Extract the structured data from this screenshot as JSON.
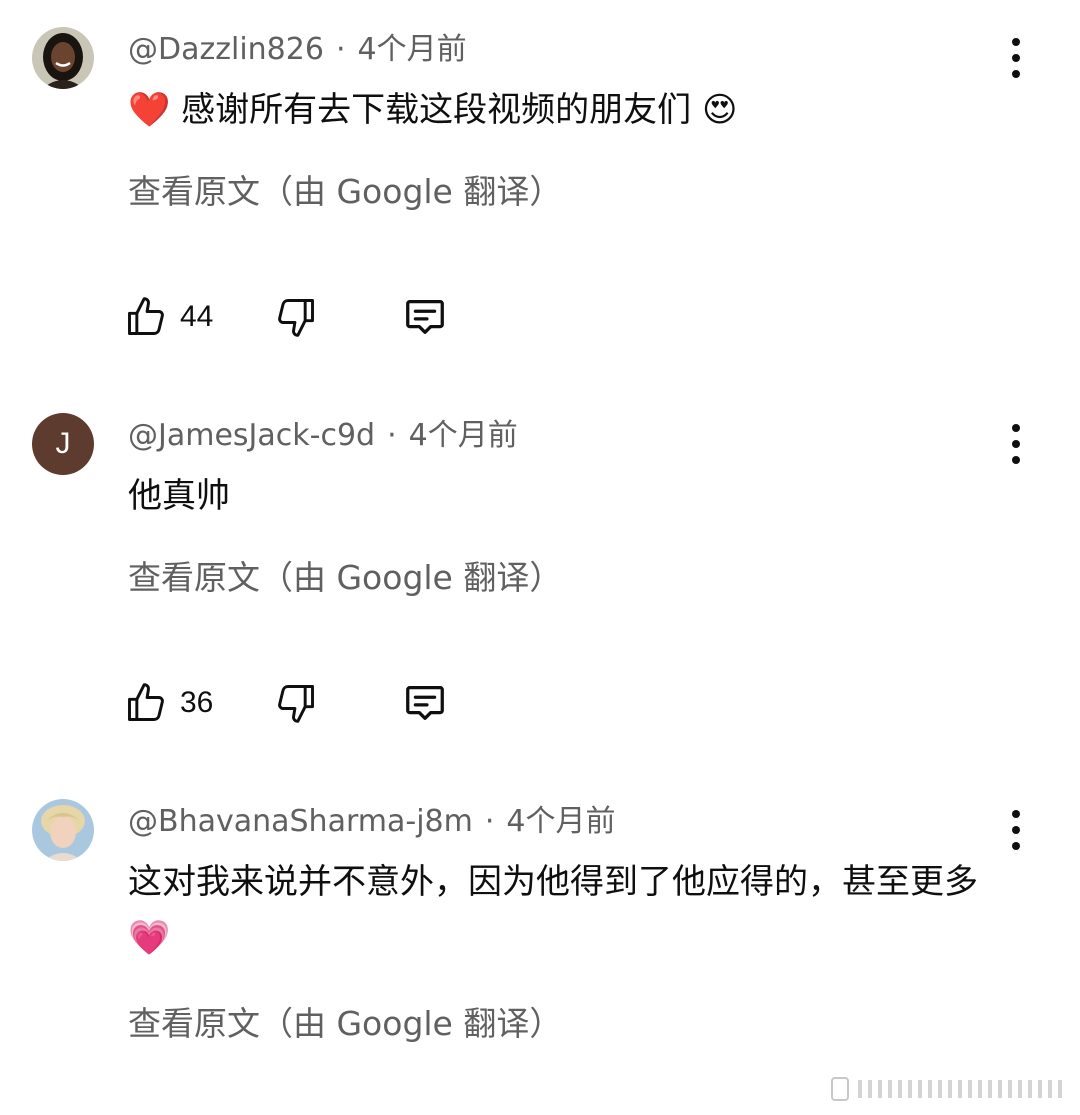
{
  "comments": [
    {
      "handle": "@Dazzlin826",
      "age": "4个月前",
      "text_emoji_lead": "❤️",
      "text": "感谢所有去下载这段视频的朋友们",
      "text_emoji_trail": "😍",
      "translate_label": "查看原文（由 Google 翻译）",
      "likes": "44"
    },
    {
      "handle": "@JamesJack-c9d",
      "age": "4个月前",
      "avatar_letter": "J",
      "text": "他真帅",
      "translate_label": "查看原文（由 Google 翻译）",
      "likes": "36"
    },
    {
      "handle": "@BhavanaSharma-j8m",
      "age": "4个月前",
      "text": "这对我来说并不意外，因为他得到了他应得的，甚至更多",
      "text_emoji_trail": "💗",
      "translate_label": "查看原文（由 Google 翻译）"
    }
  ],
  "separator": "·",
  "colors": {
    "avatar_j": "#5d3b2f",
    "secondary_text": "#606060"
  }
}
